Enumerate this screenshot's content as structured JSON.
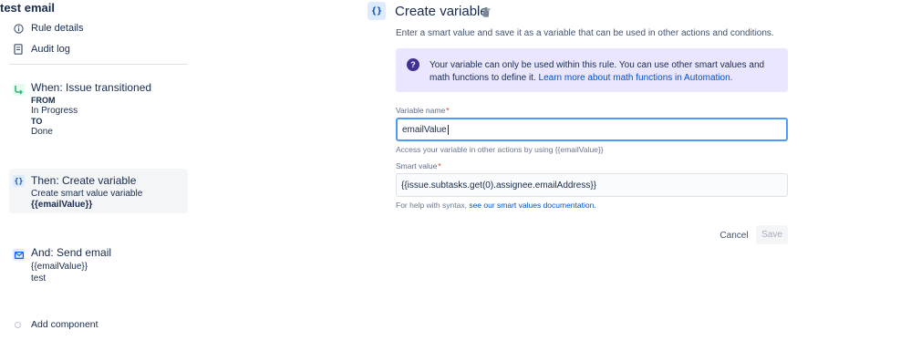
{
  "sidebar": {
    "rule_title": "test email",
    "links": [
      {
        "label": "Rule details",
        "icon": "info-icon"
      },
      {
        "label": "Audit log",
        "icon": "document-icon"
      }
    ],
    "trigger": {
      "title": "When: Issue transitioned",
      "from_label": "FROM",
      "from_value": "In Progress",
      "to_label": "TO",
      "to_value": "Done",
      "icon": "transition-icon"
    },
    "action_variable": {
      "title": "Then: Create variable",
      "subtitle": "Create smart value variable",
      "value": "{{emailValue}}",
      "icon": "braces-icon"
    },
    "action_email": {
      "title": "And: Send email",
      "line1": "{{emailValue}}",
      "line2": "test",
      "icon": "mail-icon"
    },
    "add_component": "Add component"
  },
  "panel": {
    "icon_text": "{}",
    "title": "Create variable",
    "description": "Enter a smart value and save it as a variable that can be used in other actions and conditions.",
    "info": {
      "text": "Your variable can only be used within this rule. You can use other smart values and math functions to define it. ",
      "link": "Learn more about math functions in Automation."
    },
    "variable_name": {
      "label": "Variable name",
      "required": "*",
      "value": "emailValue",
      "help": "Access your variable in other actions by using {{emailValue}}"
    },
    "smart_value": {
      "label": "Smart value",
      "required": "*",
      "value": "{{issue.subtasks.get(0).assignee.emailAddress}}",
      "help": "For help with syntax, ",
      "help_link": "see our smart values documentation."
    },
    "buttons": {
      "cancel": "Cancel",
      "save": "Save"
    }
  },
  "colors": {
    "accent": "#0052cc",
    "info_bg": "#eae6ff",
    "focus_border": "#4c9aff",
    "trigger_green": "#36b37e",
    "action_blue": "#0065ff"
  }
}
